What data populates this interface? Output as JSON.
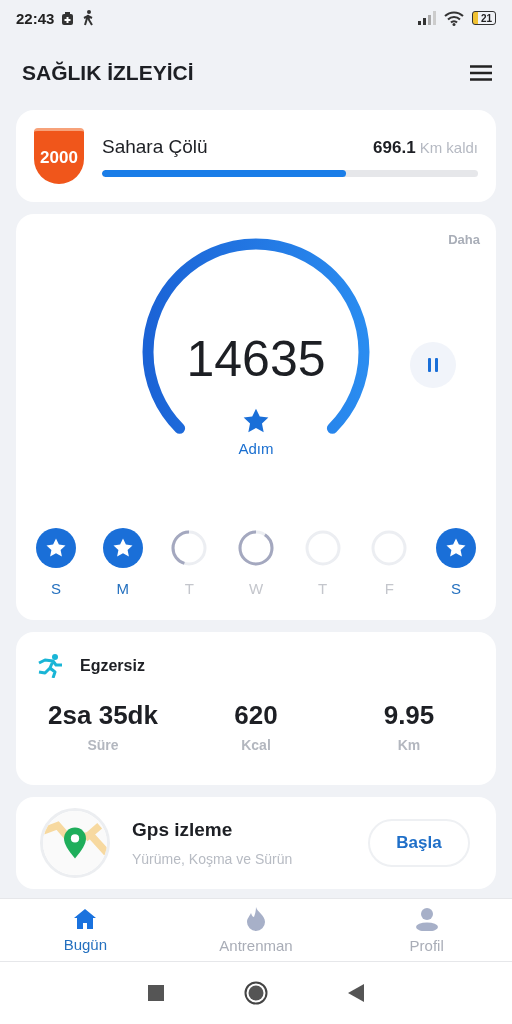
{
  "status_bar": {
    "time": "22:43",
    "battery": "21"
  },
  "header": {
    "title": "SAĞLIK İZLEYİCİ"
  },
  "challenge": {
    "badge": "2000",
    "name": "Sahara Çölü",
    "remaining": "696.1",
    "unit": "Km kaldı",
    "level": 0.65
  },
  "steps": {
    "more": "Daha",
    "count": "14635",
    "label": "Adım",
    "paused": false
  },
  "days": [
    {
      "label": "S",
      "kind": "goal"
    },
    {
      "label": "M",
      "kind": "goal"
    },
    {
      "label": "T",
      "kind": "half"
    },
    {
      "label": "W",
      "kind": "most"
    },
    {
      "label": "T",
      "kind": "none"
    },
    {
      "label": "F",
      "kind": "none"
    },
    {
      "label": "S",
      "kind": "goal"
    }
  ],
  "exercise": {
    "title": "Egzersiz",
    "stats": [
      {
        "value": "2sa 35dk",
        "label": "Süre"
      },
      {
        "value": "620",
        "label": "Kcal"
      },
      {
        "value": "9.95",
        "label": "Km"
      }
    ]
  },
  "gps": {
    "title": "Gps izleme",
    "subtitle": "Yürüme, Koşma ve Sürün",
    "button": "Başla"
  },
  "nav": [
    {
      "label": "Bugün",
      "kind": "home",
      "selected": true
    },
    {
      "label": "Antrenman",
      "kind": "fire",
      "selected": false
    },
    {
      "label": "Profil",
      "kind": "person",
      "selected": false
    }
  ]
}
